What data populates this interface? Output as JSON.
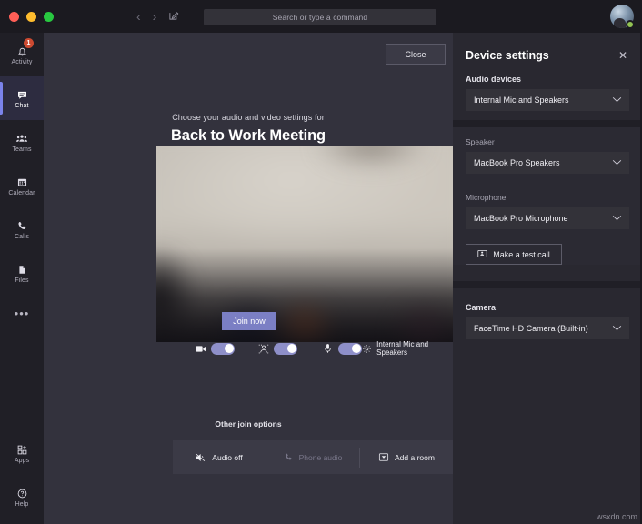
{
  "titlebar": {
    "nav_back": "‹",
    "nav_forward": "›",
    "compose_icon": "compose-icon",
    "search_placeholder": "Search or type a command",
    "avatar_presence": "available"
  },
  "rail": {
    "items": [
      {
        "label": "Activity",
        "icon": "bell-icon",
        "badge": "1",
        "active": false
      },
      {
        "label": "Chat",
        "icon": "chat-icon",
        "badge": "",
        "active": true
      },
      {
        "label": "Teams",
        "icon": "teams-icon",
        "badge": "",
        "active": false
      },
      {
        "label": "Calendar",
        "icon": "calendar-icon",
        "badge": "",
        "active": false
      },
      {
        "label": "Calls",
        "icon": "phone-icon",
        "badge": "",
        "active": false
      },
      {
        "label": "Files",
        "icon": "files-icon",
        "badge": "",
        "active": false
      }
    ],
    "more_label": "•••",
    "bottom_items": [
      {
        "label": "Apps",
        "icon": "apps-icon"
      },
      {
        "label": "Help",
        "icon": "help-icon"
      }
    ]
  },
  "stage": {
    "close_label": "Close",
    "subtitle": "Choose your audio and video settings for",
    "meeting_title": "Back to Work Meeting",
    "join_now_label": "Join now",
    "controls": {
      "camera_icon": "video-camera-icon",
      "camera_on": true,
      "background_icon": "background-blur-icon",
      "background_on": true,
      "mic_icon": "microphone-icon",
      "mic_on": true,
      "device_gear_icon": "gear-icon",
      "device_label": "Internal Mic and Speakers"
    },
    "other_join_label": "Other join options",
    "join_options": [
      {
        "label": "Audio off",
        "icon": "speaker-muted-icon",
        "disabled": false
      },
      {
        "label": "Phone audio",
        "icon": "phone-icon",
        "disabled": true
      },
      {
        "label": "Add a room",
        "icon": "room-icon",
        "disabled": false
      }
    ]
  },
  "panel": {
    "title": "Device settings",
    "close_icon": "close-icon",
    "audio_devices_label": "Audio devices",
    "audio_devices_value": "Internal Mic and Speakers",
    "speaker_label": "Speaker",
    "speaker_value": "MacBook Pro Speakers",
    "microphone_label": "Microphone",
    "microphone_value": "MacBook Pro Microphone",
    "test_call_label": "Make a test call",
    "test_call_icon": "test-call-icon",
    "camera_label": "Camera",
    "camera_value": "FaceTime HD Camera (Built-in)",
    "chevron_icon": "chevron-down-icon"
  },
  "watermark": "wsxdn.com",
  "colors": {
    "accent": "#7b83eb",
    "toggle_on": "#8e8fc9",
    "join_now": "#7b7fc4",
    "badge": "#cc4a31",
    "presence_green": "#92c353"
  }
}
